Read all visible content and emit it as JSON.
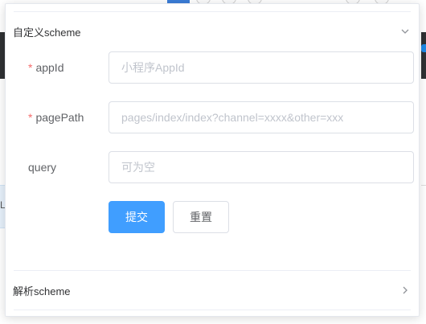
{
  "custom_section": {
    "title": "自定义scheme",
    "expanded": true,
    "form": {
      "appid": {
        "label": "appId",
        "required": true,
        "value": "",
        "placeholder": "小程序AppId"
      },
      "pagepath": {
        "label": "pagePath",
        "required": true,
        "value": "",
        "placeholder": "pages/index/index?channel=xxxx&other=xxx"
      },
      "query": {
        "label": "query",
        "required": false,
        "value": "",
        "placeholder": "可为空"
      },
      "submit_label": "提交",
      "reset_label": "重置"
    }
  },
  "parse_section": {
    "title": "解析scheme",
    "expanded": false
  },
  "icons": {
    "collapse": "chevron-down-icon",
    "expand": "chevron-right-icon"
  },
  "background": {
    "left_cell_text": "La"
  },
  "colors": {
    "primary": "#409eff",
    "required": "#f56c6c",
    "border": "#dcdfe6",
    "placeholder": "#c0c4cc"
  }
}
